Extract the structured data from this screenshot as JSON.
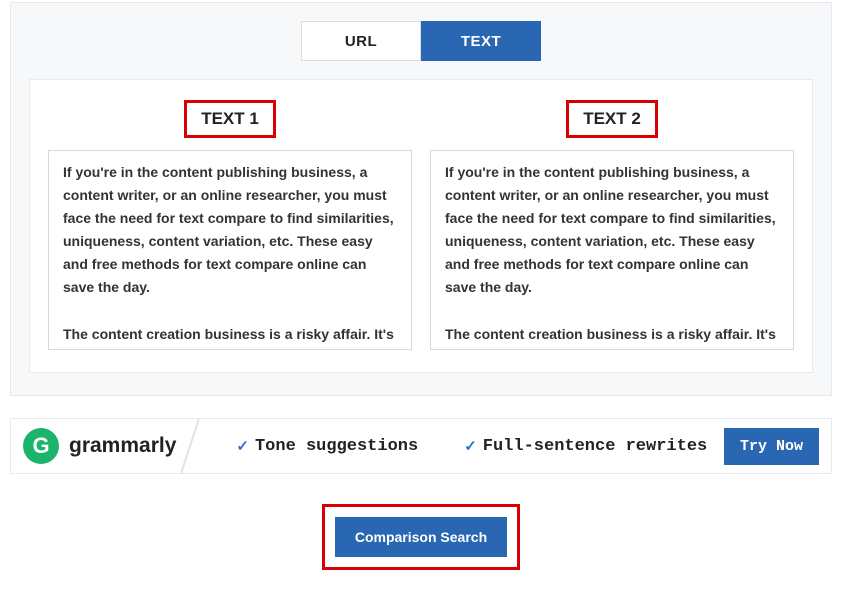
{
  "tabs": {
    "url": "URL",
    "text": "TEXT"
  },
  "columns": {
    "left": {
      "header": "TEXT 1",
      "content": "If you're in the content publishing business, a content writer, or an online researcher, you must face the need for text compare to find similarities, uniqueness, content variation, etc. These easy and free methods for text compare online can save the day.\n\nThe content creation business is a risky affair. It's"
    },
    "right": {
      "header": "TEXT 2",
      "content": "If you're in the content publishing business, a content writer, or an online researcher, you must face the need for text compare to find similarities, uniqueness, content variation, etc. These easy and free methods for text compare online can save the day.\n\nThe content creation business is a risky affair. It's"
    }
  },
  "ad": {
    "brand": "grammarly",
    "feature1": "Tone suggestions",
    "feature2": "Full-sentence rewrites",
    "cta": "Try Now"
  },
  "action": {
    "label": "Comparison Search"
  }
}
